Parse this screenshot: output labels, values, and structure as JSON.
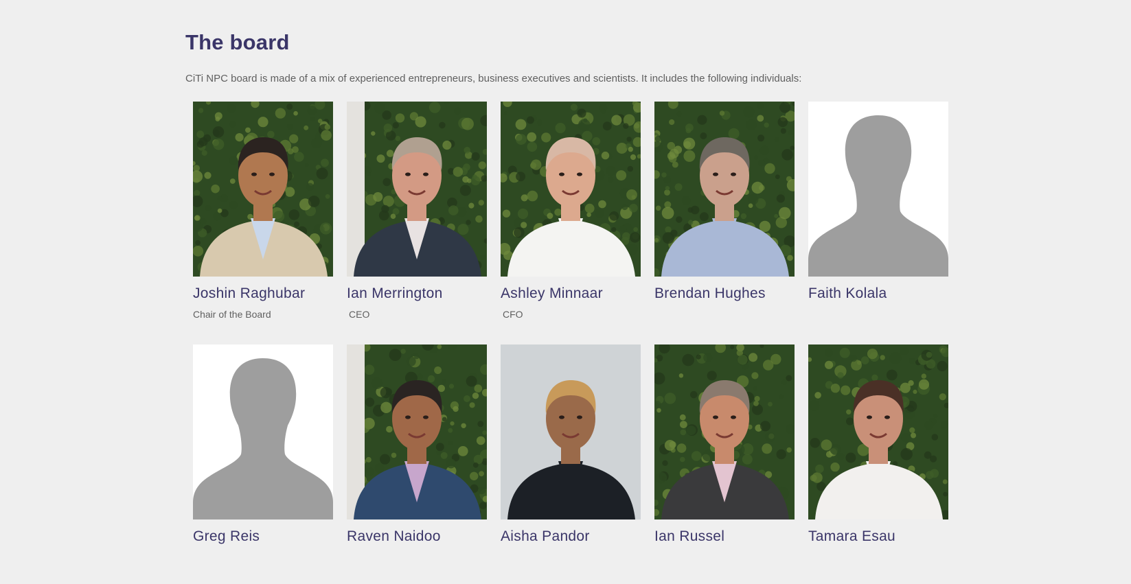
{
  "page": {
    "title": "The board",
    "intro": "CiTi NPC board is made of a mix of experienced entrepreneurs, business executives and scientists. It includes the following individuals:"
  },
  "colors": {
    "background": "#efefef",
    "heading": "#3a3568",
    "body_text": "#5f5f5f",
    "hedge_dark": "#2e4a22",
    "hedge_light": "#5e7a33",
    "placeholder_bg": "#ffffff",
    "placeholder_silhouette": "#9e9e9e"
  },
  "members": [
    {
      "name": "Joshin Raghubar",
      "role": "Chair of the Board",
      "photo": "hedge",
      "skin": "#b07850",
      "hair": "#2b2320",
      "jacket": "#d8c9ae",
      "shirt": "#c9d7ea"
    },
    {
      "name": "Ian Merrington",
      "role": "CEO",
      "photo": "hedge-wall",
      "skin": "#d39a84",
      "hair": "#b0a090",
      "jacket": "#2f3846",
      "shirt": "#e8e2e2"
    },
    {
      "name": "Ashley Minnaar",
      "role": "CFO",
      "photo": "hedge",
      "skin": "#dca98e",
      "hair": "#d8b8a5",
      "jacket": "#f4f4f2",
      "shirt": "#f4f4f2"
    },
    {
      "name": "Brendan Hughes",
      "role": "",
      "photo": "hedge",
      "skin": "#caa08c",
      "hair": "#6e6860",
      "jacket": "#a9b8d6",
      "shirt": "#a9b8d6"
    },
    {
      "name": "Faith Kolala",
      "role": "",
      "photo": "placeholder"
    },
    {
      "name": "Greg Reis",
      "role": "",
      "photo": "placeholder"
    },
    {
      "name": "Raven Naidoo",
      "role": "",
      "photo": "hedge-wall",
      "skin": "#a06848",
      "hair": "#2a2422",
      "jacket": "#2f4a6e",
      "shirt": "#c7a6cc"
    },
    {
      "name": "Aisha Pandor",
      "role": "",
      "photo": "grey",
      "skin": "#9a6a4a",
      "hair": "#c89a5a",
      "jacket": "#1c2026",
      "shirt": "#1c2026"
    },
    {
      "name": "Ian Russel",
      "role": "",
      "photo": "hedge",
      "skin": "#c88a6c",
      "hair": "#8a7a6e",
      "jacket": "#3a3a3c",
      "shirt": "#e3c4d0"
    },
    {
      "name": "Tamara Esau",
      "role": "",
      "photo": "hedge",
      "skin": "#c99078",
      "hair": "#4a3026",
      "jacket": "#f2f0ee",
      "shirt": "#f2f0ee"
    }
  ]
}
